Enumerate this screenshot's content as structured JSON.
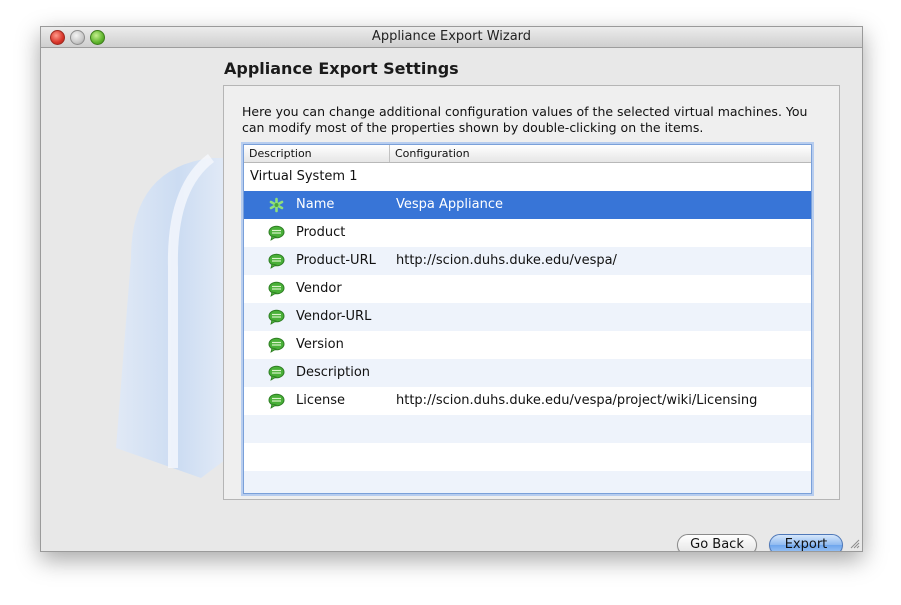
{
  "window": {
    "title": "Appliance Export Wizard"
  },
  "page": {
    "heading": "Appliance Export Settings",
    "description": "Here you can change additional configuration values of the selected virtual machines. You can modify most of the properties shown by double-clicking on the items."
  },
  "table": {
    "columns": [
      "Description",
      "Configuration"
    ],
    "group": "Virtual System 1",
    "rows": [
      {
        "key": "Name",
        "value": "Vespa Appliance",
        "icon": "name-star-icon",
        "selected": true
      },
      {
        "key": "Product",
        "value": "",
        "icon": "speech-bubble-icon"
      },
      {
        "key": "Product-URL",
        "value": "http://scion.duhs.duke.edu/vespa/",
        "icon": "speech-bubble-icon"
      },
      {
        "key": "Vendor",
        "value": "",
        "icon": "speech-bubble-icon"
      },
      {
        "key": "Vendor-URL",
        "value": "",
        "icon": "speech-bubble-icon"
      },
      {
        "key": "Version",
        "value": "",
        "icon": "speech-bubble-icon"
      },
      {
        "key": "Description",
        "value": "",
        "icon": "speech-bubble-icon"
      },
      {
        "key": "License",
        "value": "http://scion.duhs.duke.edu/vespa/project/wiki/Licensing",
        "icon": "speech-bubble-icon"
      }
    ]
  },
  "buttons": {
    "back": "Go Back",
    "export": "Export"
  },
  "colors": {
    "selection": "#3875d7",
    "alt_row": "#eef3fb",
    "default_button": "#6ea6ee"
  }
}
